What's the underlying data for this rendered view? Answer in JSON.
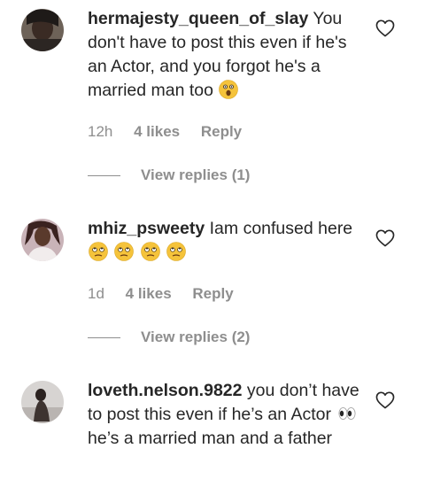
{
  "comments": [
    {
      "username": "hermajesty_queen_of_slay",
      "text": "You don't have to post this even if he's an Actor, and you forgot he's a married man too",
      "time": "12h",
      "likes": "4 likes",
      "reply_label": "Reply",
      "view_replies": "View replies (1)",
      "emojis": [
        "astonished-face-emoji"
      ]
    },
    {
      "username": "mhiz_psweety",
      "text": "Iam confused here",
      "time": "1d",
      "likes": "4 likes",
      "reply_label": "Reply",
      "view_replies": "View replies (2)",
      "emojis": [
        "eye-roll-emoji",
        "eye-roll-emoji",
        "eye-roll-emoji",
        "eye-roll-emoji"
      ]
    },
    {
      "username": "loveth.nelson.9822",
      "text_before": "you don’t have to post this even if he’s an Actor",
      "text_after": "he’s a married man and a father",
      "emojis": [
        "eyes-emoji"
      ]
    }
  ],
  "colors": {
    "text": "#262626",
    "secondary": "#8e8e8e",
    "emoji": "#f5c33b"
  },
  "icons": [
    "heart-outline-icon"
  ]
}
